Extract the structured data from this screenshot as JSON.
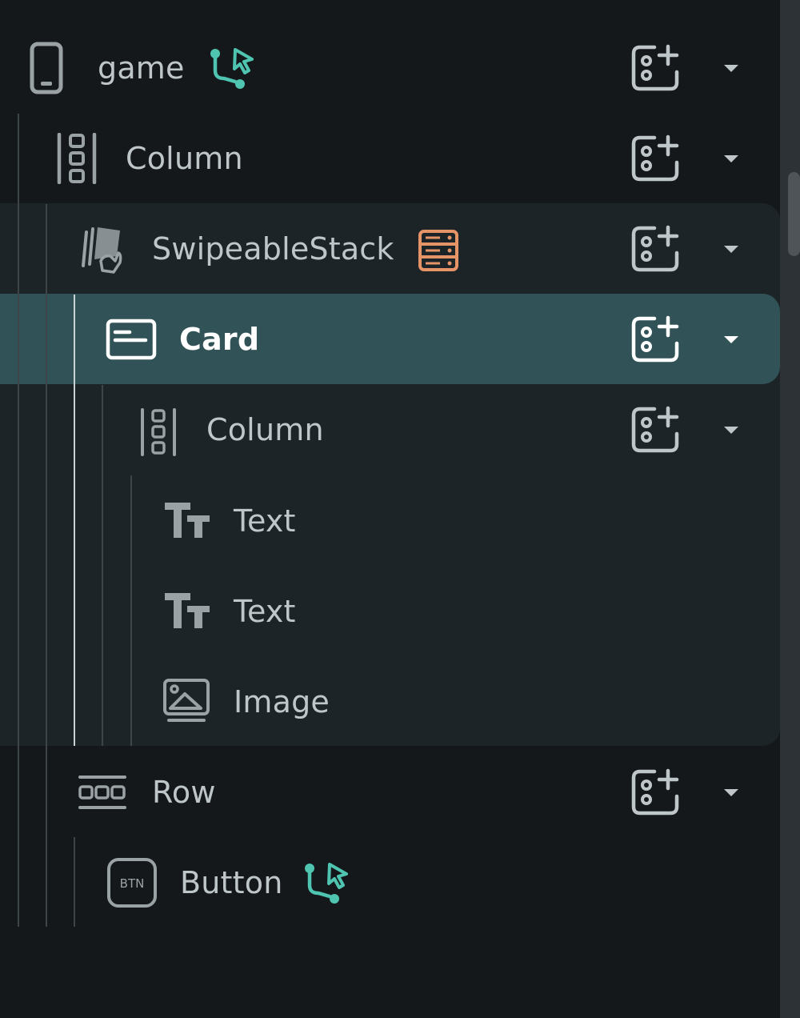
{
  "tree": {
    "nodes": [
      {
        "label": "game",
        "icon": "phone-icon",
        "badge": "action-flow-icon"
      },
      {
        "label": "Column",
        "icon": "column-icon"
      },
      {
        "label": "SwipeableStack",
        "icon": "swipeable-stack-icon",
        "badge": "backend-query-icon"
      },
      {
        "label": "Card",
        "icon": "card-icon",
        "selected": true
      },
      {
        "label": "Column",
        "icon": "column-icon"
      },
      {
        "label": "Text",
        "icon": "text-icon"
      },
      {
        "label": "Text",
        "icon": "text-icon"
      },
      {
        "label": "Image",
        "icon": "image-icon"
      },
      {
        "label": "Row",
        "icon": "row-icon"
      },
      {
        "label": "Button",
        "icon": "button-icon",
        "button_icon_text": "BTN",
        "badge": "action-flow-icon"
      }
    ]
  },
  "colors": {
    "panel_bg": "#14181b",
    "group_bg": "#1d2428",
    "selected_bg": "#315256",
    "text": "#bfc6ca",
    "selected_text": "#ffffff",
    "action_badge": "#4fc4b0",
    "query_badge": "#e59468"
  }
}
